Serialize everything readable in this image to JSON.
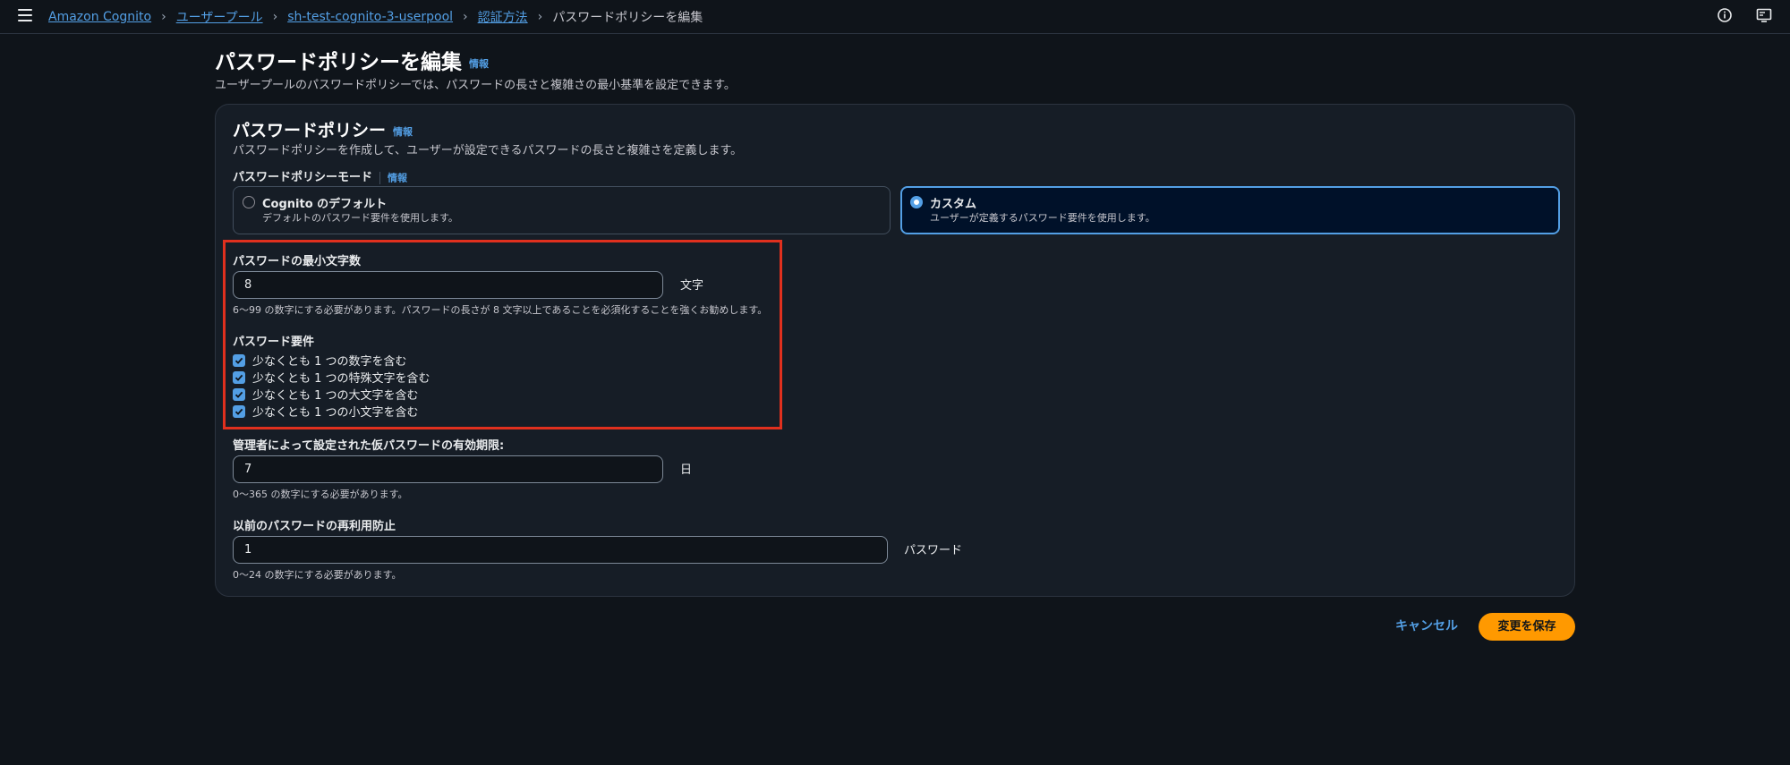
{
  "breadcrumbs": {
    "items": [
      "Amazon Cognito",
      "ユーザープール",
      "sh-test-cognito-3-userpool",
      "認証方法"
    ],
    "current": "パスワードポリシーを編集"
  },
  "page": {
    "title": "パスワードポリシーを編集",
    "info": "情報",
    "description": "ユーザープールのパスワードポリシーでは、パスワードの長さと複雑さの最小基準を設定できます。"
  },
  "section": {
    "title": "パスワードポリシー",
    "info": "情報",
    "description": "パスワードポリシーを作成して、ユーザーが設定できるパスワードの長さと複雑さを定義します。"
  },
  "mode": {
    "label": "パスワードポリシーモード",
    "info": "情報",
    "options": [
      {
        "title": "Cognito のデフォルト",
        "desc": "デフォルトのパスワード要件を使用します。",
        "selected": false
      },
      {
        "title": "カスタム",
        "desc": "ユーザーが定義するパスワード要件を使用します。",
        "selected": true
      }
    ]
  },
  "min_length": {
    "label": "パスワードの最小文字数",
    "value": "8",
    "unit": "文字",
    "hint": "6〜99 の数字にする必要があります。パスワードの長さが 8 文字以上であることを必須化することを強くお勧めします。"
  },
  "requirements": {
    "label": "パスワード要件",
    "items": [
      "少なくとも 1 つの数字を含む",
      "少なくとも 1 つの特殊文字を含む",
      "少なくとも 1 つの大文字を含む",
      "少なくとも 1 つの小文字を含む"
    ]
  },
  "temp_expiry": {
    "label": "管理者によって設定された仮パスワードの有効期限:",
    "value": "7",
    "unit": "日",
    "hint": "0〜365 の数字にする必要があります。"
  },
  "reuse": {
    "label": "以前のパスワードの再利用防止",
    "value": "1",
    "unit": "パスワード",
    "hint": "0〜24 の数字にする必要があります。"
  },
  "actions": {
    "cancel": "キャンセル",
    "save": "変更を保存"
  },
  "colors": {
    "background": "#0f141a",
    "link": "#539fe5",
    "primary": "#ff9900",
    "highlight": "#e0301e"
  }
}
